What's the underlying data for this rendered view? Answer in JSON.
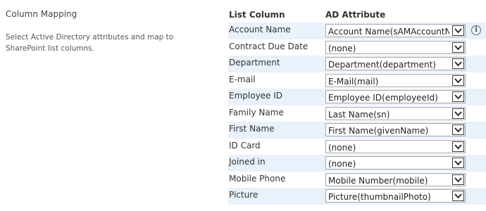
{
  "section": {
    "title": "Column Mapping",
    "description": "Select Active Directory attributes and map to SharePoint list columns."
  },
  "headers": {
    "list_column": "List Column",
    "ad_attribute": "AD Attribute"
  },
  "info_icon": {
    "icon": "info-icon",
    "glyph": "i"
  },
  "rows": [
    {
      "label": "Account Name",
      "value": "Account Name(sAMAccountName)"
    },
    {
      "label": "Contract Due Date",
      "value": "(none)"
    },
    {
      "label": "Department",
      "value": "Department(department)"
    },
    {
      "label": "E-mail",
      "value": "E-Mail(mail)"
    },
    {
      "label": "Employee ID",
      "value": "Employee ID(employeeId)"
    },
    {
      "label": "Family Name",
      "value": "Last Name(sn)"
    },
    {
      "label": "First Name",
      "value": "First Name(givenName)"
    },
    {
      "label": "ID Card",
      "value": "(none)"
    },
    {
      "label": "Joined in",
      "value": "(none)"
    },
    {
      "label": "Mobile Phone",
      "value": "Mobile Number(mobile)"
    },
    {
      "label": "Picture",
      "value": "Picture(thumbnailPhoto)"
    }
  ]
}
